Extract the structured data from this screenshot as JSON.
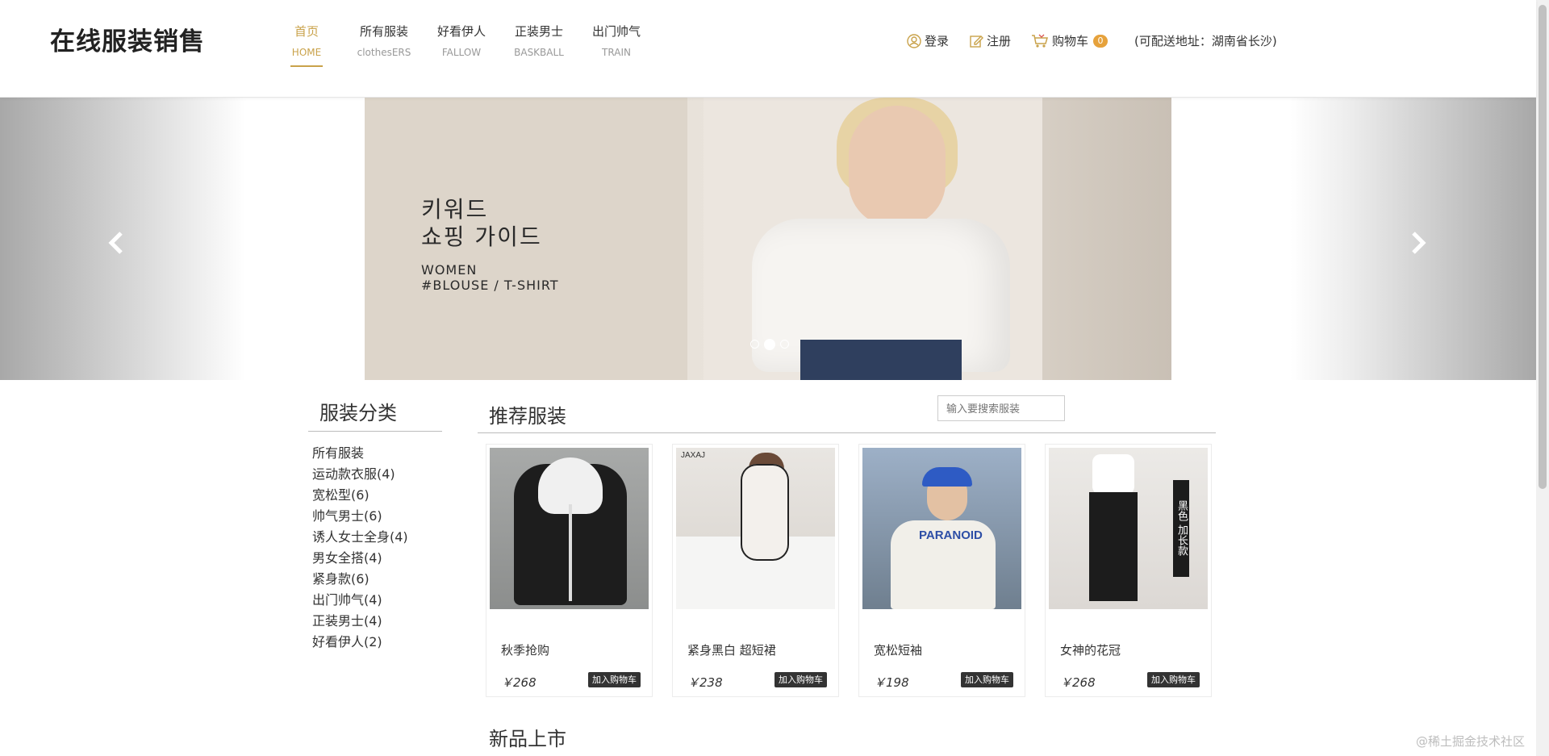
{
  "header": {
    "logo": "在线服装销售",
    "nav": [
      {
        "cn": "首页",
        "en": "HOME"
      },
      {
        "cn": "所有服装",
        "en": "clothesERS"
      },
      {
        "cn": "好看伊人",
        "en": "FALLOW"
      },
      {
        "cn": "正装男士",
        "en": "BASKBALL"
      },
      {
        "cn": "出门帅气",
        "en": "TRAIN"
      }
    ],
    "login": "登录",
    "register": "注册",
    "cart": "购物车",
    "cart_count": "0",
    "address": "(可配送地址：湖南省长沙)"
  },
  "carousel": {
    "kr_line1": "키워드",
    "kr_line2": "쇼핑 가이드",
    "en_line1": "WOMEN",
    "en_line2": "#BLOUSE / T-SHIRT",
    "active_slide": 2,
    "slide_count": 3
  },
  "sidebar": {
    "title": "服装分类",
    "categories": [
      "所有服装",
      "运动款衣服(4)",
      "宽松型(6)",
      "帅气男士(6)",
      "诱人女士全身(4)",
      "男女全搭(4)",
      "紧身款(6)",
      "出门帅气(4)",
      "正装男士(4)",
      "好看伊人(2)"
    ]
  },
  "main": {
    "recommend_title": "推荐服装",
    "search_placeholder": "输入要搜索服装",
    "add_to_cart": "加入购物车",
    "products": [
      {
        "name": "秋季抢购",
        "price": "￥268"
      },
      {
        "name": "紧身黑白 超短裙",
        "price": "￥238"
      },
      {
        "name": "宽松短袖",
        "price": "￥198"
      },
      {
        "name": "女神的花冠",
        "price": "￥268"
      }
    ],
    "product_image_text": {
      "brand": "JAXAJ",
      "print": "PARANOID",
      "tag": "黑色 加长款"
    },
    "new_title": "新品上市"
  },
  "watermark": "@稀土掘金技术社区",
  "colors": {
    "accent": "#c9a24a",
    "badge": "#e6a23c",
    "button": "#333333"
  }
}
